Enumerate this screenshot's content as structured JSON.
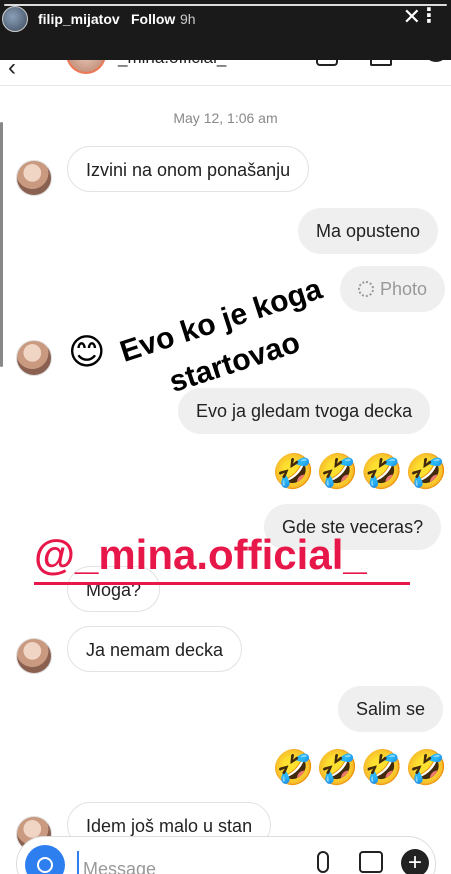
{
  "story": {
    "username": "filip_mijatov",
    "follow_label": "Follow",
    "time": "9h",
    "more_icon": "more-vertical-icon",
    "close_icon": "close-icon",
    "close_glyph": "✕",
    "more_glyph": "⋮"
  },
  "chat": {
    "header_name": "_mina.official_",
    "back_glyph": "‹",
    "timestamp": "May 12, 1:06 am",
    "messages": [
      {
        "side": "in",
        "text": "Izvini na onom ponašanju"
      },
      {
        "side": "out",
        "text": "Ma opusteno"
      },
      {
        "side": "out",
        "text": "Photo"
      },
      {
        "side": "in",
        "text": "😊"
      },
      {
        "side": "out",
        "text": "Evo ja gledam tvoga decka"
      },
      {
        "side": "out",
        "text": "🤣🤣🤣🤣"
      },
      {
        "side": "out",
        "text": "Gde ste veceras?"
      },
      {
        "side": "in",
        "text": "Moga?"
      },
      {
        "side": "in",
        "text": "Ja nemam decka"
      },
      {
        "side": "out",
        "text": "Salim se"
      },
      {
        "side": "out",
        "text": "🤣🤣🤣🤣"
      },
      {
        "side": "in",
        "text": "Idem još malo u stan"
      }
    ],
    "input_placeholder": "Message",
    "plus_glyph": "+"
  },
  "overlay": {
    "quote_line1": "Evo ko je koga",
    "quote_line2": "startovao",
    "mention": "@_mina.official_"
  }
}
